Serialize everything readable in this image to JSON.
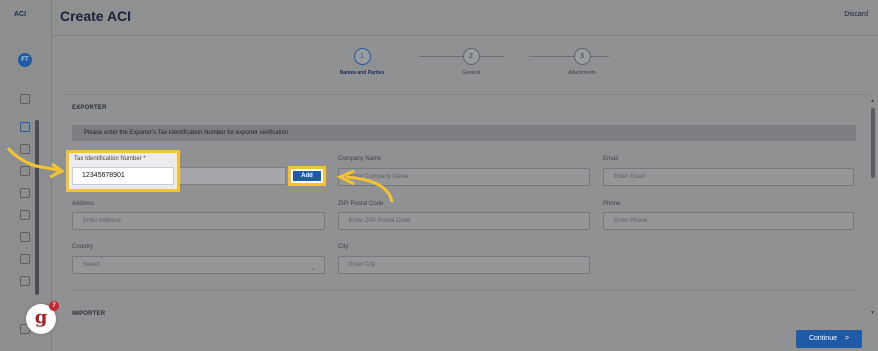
{
  "app": {
    "logo": "ACI",
    "user_initials": "FT",
    "title": "Create ACI",
    "discard_label": "Discard"
  },
  "stepper": [
    {
      "number": "1",
      "label": "Names and Parties",
      "active": true
    },
    {
      "number": "2",
      "label": "General",
      "active": false
    },
    {
      "number": "3",
      "label": "Attachments",
      "active": false
    }
  ],
  "exporter": {
    "section_title": "EXPORTER",
    "banner": "Please enter the Exporter's Tax Identification Number for exporter verification.",
    "tin_label": "Tax Identification Number *",
    "tin_value": "12345678901",
    "add_label": "Add",
    "company_label": "Company Name",
    "company_placeholder": "Enter Company Name",
    "email_label": "Email",
    "email_placeholder": "Enter Email",
    "address_label": "Address",
    "address_placeholder": "Enter Address",
    "zip_label": "ZIP/ Postal Code",
    "zip_placeholder": "Enter ZIP/ Postal Code",
    "phone_label": "Phone",
    "phone_placeholder": "Enter Phone",
    "country_label": "Country",
    "country_value": "Select",
    "city_label": "City",
    "city_placeholder": "Enter City"
  },
  "importer": {
    "section_title": "IMPORTER"
  },
  "footer": {
    "continue_label": "Continue",
    "continue_icon": ">"
  },
  "brand": {
    "letter": "g",
    "badge": "7"
  },
  "colors": {
    "highlight": "#f4c430",
    "primary": "#1f5aa6"
  },
  "icons": [
    "dashboard-icon",
    "document-icon",
    "list-icon",
    "box-icon",
    "history-icon",
    "file-icon",
    "gear-icon",
    "truck-icon",
    "storage-icon",
    "logout-icon",
    "chevron-down-icon",
    "chevron-right-icon"
  ]
}
